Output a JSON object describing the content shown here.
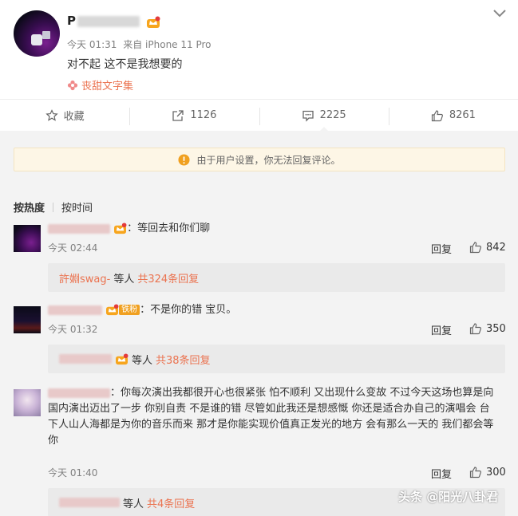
{
  "post": {
    "username_visible": "P",
    "meta_time": "今天 01:31",
    "meta_source": "来自 iPhone 11 Pro",
    "text": "对不起 这不是我想要的",
    "topic": "丧甜文字集",
    "badge_icon": "vip-crown-icon"
  },
  "actions": [
    {
      "label": "收藏",
      "icon": "star-icon"
    },
    {
      "label": "1126",
      "icon": "repost-icon"
    },
    {
      "label": "2225",
      "icon": "comment-icon"
    },
    {
      "label": "8261",
      "icon": "like-icon"
    }
  ],
  "notice": {
    "text": "由于用户设置，你无法回复评论。",
    "icon": "warning-icon",
    "color": "#f0a020"
  },
  "sort": {
    "hot": "按热度",
    "time": "按时间"
  },
  "comments": [
    {
      "text": "：等回去和你们聊",
      "time": "今天 02:44",
      "reply": "回复",
      "likes": "842",
      "sub_who": "許婣swag-",
      "sub_mid": "等人",
      "sub_count": "共324条回复"
    },
    {
      "badge": "铁粉",
      "text": "：不是你的错 宝贝。",
      "time": "今天 01:32",
      "reply": "回复",
      "likes": "350",
      "sub_mid": "等人",
      "sub_count": "共38条回复"
    },
    {
      "text_line1": "：你每次演出我都很开心也很紧张 怕不顺利 又出现什么变故 不过今天这场也算是向",
      "text_line2": "国内演出迈出了一步 你别自责 不是谁的错 尽管如此我还是想感慨 你还是适合办自己的演唱会 台",
      "text_line3": "下人山人海都是为你的音乐而来 那才是你能实现价值真正发光的地方 会有那么一天的 我们都会等",
      "text_line4": "你",
      "time": "今天 01:40",
      "reply": "回复",
      "likes": "300",
      "sub_mid": "等人",
      "sub_count": "共4条回复"
    }
  ],
  "watermark": "头条 @阳光八卦君",
  "colors": {
    "accent": "#eb7350",
    "background": "#f3f3f3",
    "notice_bg": "#fdf6e6"
  }
}
